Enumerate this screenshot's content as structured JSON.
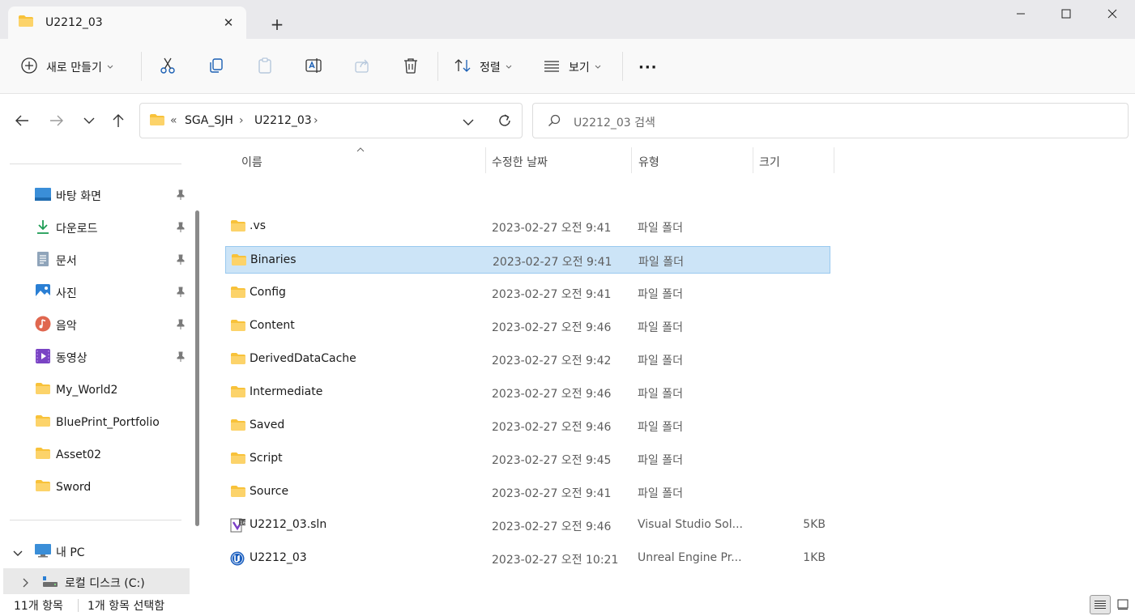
{
  "tab": {
    "title": "U2212_03",
    "close": "✕",
    "new": "+"
  },
  "window": {
    "minimize": "—",
    "maximize": "☐",
    "close": "✕"
  },
  "toolbar": {
    "new_label": "새로 만들기",
    "sort_label": "정렬",
    "view_label": "보기",
    "more_label": "···"
  },
  "address": {
    "crumb1": "SGA_SJH",
    "crumb2": "U2212_03",
    "overflow": "«"
  },
  "search": {
    "placeholder": "U2212_03 검색"
  },
  "sidebar": {
    "pinned": [
      {
        "label": "바탕 화면",
        "icon": "desktop-icon"
      },
      {
        "label": "다운로드",
        "icon": "download-icon"
      },
      {
        "label": "문서",
        "icon": "document-icon"
      },
      {
        "label": "사진",
        "icon": "pictures-icon"
      },
      {
        "label": "음악",
        "icon": "music-icon"
      },
      {
        "label": "동영상",
        "icon": "video-icon"
      }
    ],
    "folders": [
      "My_World2",
      "BluePrint_Portfolio",
      "Asset02",
      "Sword"
    ],
    "this_pc": "내 PC",
    "local_disk": "로컬 디스크 (C:)"
  },
  "columns": {
    "name": "이름",
    "date": "수정한 날짜",
    "type": "유형",
    "size": "크기"
  },
  "files": [
    {
      "name": ".vs",
      "date": "2023-02-27 오전 9:41",
      "type": "파일 폴더",
      "size": "",
      "kind": "folder"
    },
    {
      "name": "Binaries",
      "date": "2023-02-27 오전 9:41",
      "type": "파일 폴더",
      "size": "",
      "kind": "folder",
      "selected": true
    },
    {
      "name": "Config",
      "date": "2023-02-27 오전 9:41",
      "type": "파일 폴더",
      "size": "",
      "kind": "folder"
    },
    {
      "name": "Content",
      "date": "2023-02-27 오전 9:46",
      "type": "파일 폴더",
      "size": "",
      "kind": "folder"
    },
    {
      "name": "DerivedDataCache",
      "date": "2023-02-27 오전 9:42",
      "type": "파일 폴더",
      "size": "",
      "kind": "folder"
    },
    {
      "name": "Intermediate",
      "date": "2023-02-27 오전 9:46",
      "type": "파일 폴더",
      "size": "",
      "kind": "folder"
    },
    {
      "name": "Saved",
      "date": "2023-02-27 오전 9:46",
      "type": "파일 폴더",
      "size": "",
      "kind": "folder"
    },
    {
      "name": "Script",
      "date": "2023-02-27 오전 9:45",
      "type": "파일 폴더",
      "size": "",
      "kind": "folder"
    },
    {
      "name": "Source",
      "date": "2023-02-27 오전 9:41",
      "type": "파일 폴더",
      "size": "",
      "kind": "folder"
    },
    {
      "name": "U2212_03.sln",
      "date": "2023-02-27 오전 9:46",
      "type": "Visual Studio Sol...",
      "size": "5KB",
      "kind": "sln"
    },
    {
      "name": "U2212_03",
      "date": "2023-02-27 오전 10:21",
      "type": "Unreal Engine Pr...",
      "size": "1KB",
      "kind": "uproject"
    }
  ],
  "status": {
    "count": "11개 항목",
    "selected": "1개 항목 선택함"
  },
  "colors": {
    "folder": "#f8c23a",
    "selection": "#cce4f7",
    "accent": "#0067c0"
  }
}
